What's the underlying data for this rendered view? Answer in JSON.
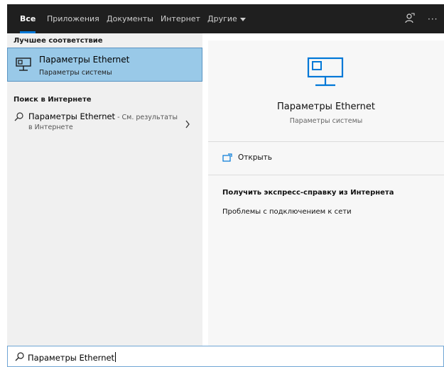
{
  "tabs": [
    {
      "label": "Все",
      "active": true
    },
    {
      "label": "Приложения",
      "active": false
    },
    {
      "label": "Документы",
      "active": false
    },
    {
      "label": "Интернет",
      "active": false
    },
    {
      "label": "Другие",
      "active": false
    }
  ],
  "topbar_icons": [
    "feedback-icon",
    "more-icon"
  ],
  "more_glyph": "···",
  "left": {
    "best_match_header": "Лучшее соответствие",
    "best_match": {
      "title": "Параметры Ethernet",
      "subtitle": "Параметры системы",
      "icon": "ethernet-icon"
    },
    "web_header": "Поиск в Интернете",
    "web_result": {
      "title": "Параметры Ethernet",
      "suffix": " - См. результаты",
      "line2": "в Интернете"
    }
  },
  "right": {
    "title": "Параметры Ethernet",
    "subtitle": "Параметры системы",
    "open_label": "Открыть",
    "help_header": "Получить экспресс-справку из Интернета",
    "help_link": "Проблемы с подключением к сети"
  },
  "search": {
    "value": "Параметры Ethernet"
  },
  "colors": {
    "accent": "#0078d7",
    "selected_bg": "#99c9e8",
    "topbar_bg": "#1f1f1f"
  }
}
